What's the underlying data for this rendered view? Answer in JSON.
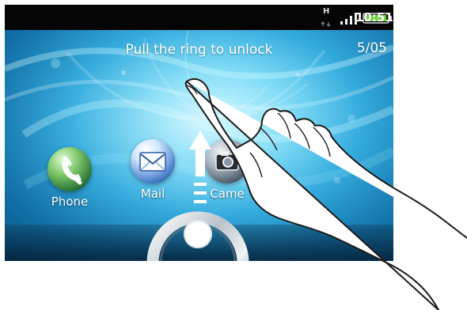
{
  "status_bar": {
    "network_type": "H",
    "time": "10:51",
    "icons": {
      "network": "network-transfer-icon",
      "signal": "signal-strength-icon",
      "battery": "battery-icon"
    },
    "colors": {
      "background": "#050505",
      "battery_fill": "#6bd43b"
    }
  },
  "lock_screen": {
    "hint": "Pull the ring to unlock",
    "date": "5/05",
    "shortcuts": [
      {
        "label": "Phone",
        "icon": "phone-icon"
      },
      {
        "label": "Mail",
        "icon": "mail-icon"
      },
      {
        "label": "Came",
        "icon": "camera-icon"
      }
    ],
    "gesture_icon": "up-arrow-icon",
    "unlock_control_icon": "unlock-ring-icon",
    "overlay_icon": "pointing-hand-icon",
    "colors": {
      "wallpaper_primary": "#2ea7db",
      "wallpaper_highlight": "#b8f2ff",
      "text": "#ffffff"
    }
  }
}
